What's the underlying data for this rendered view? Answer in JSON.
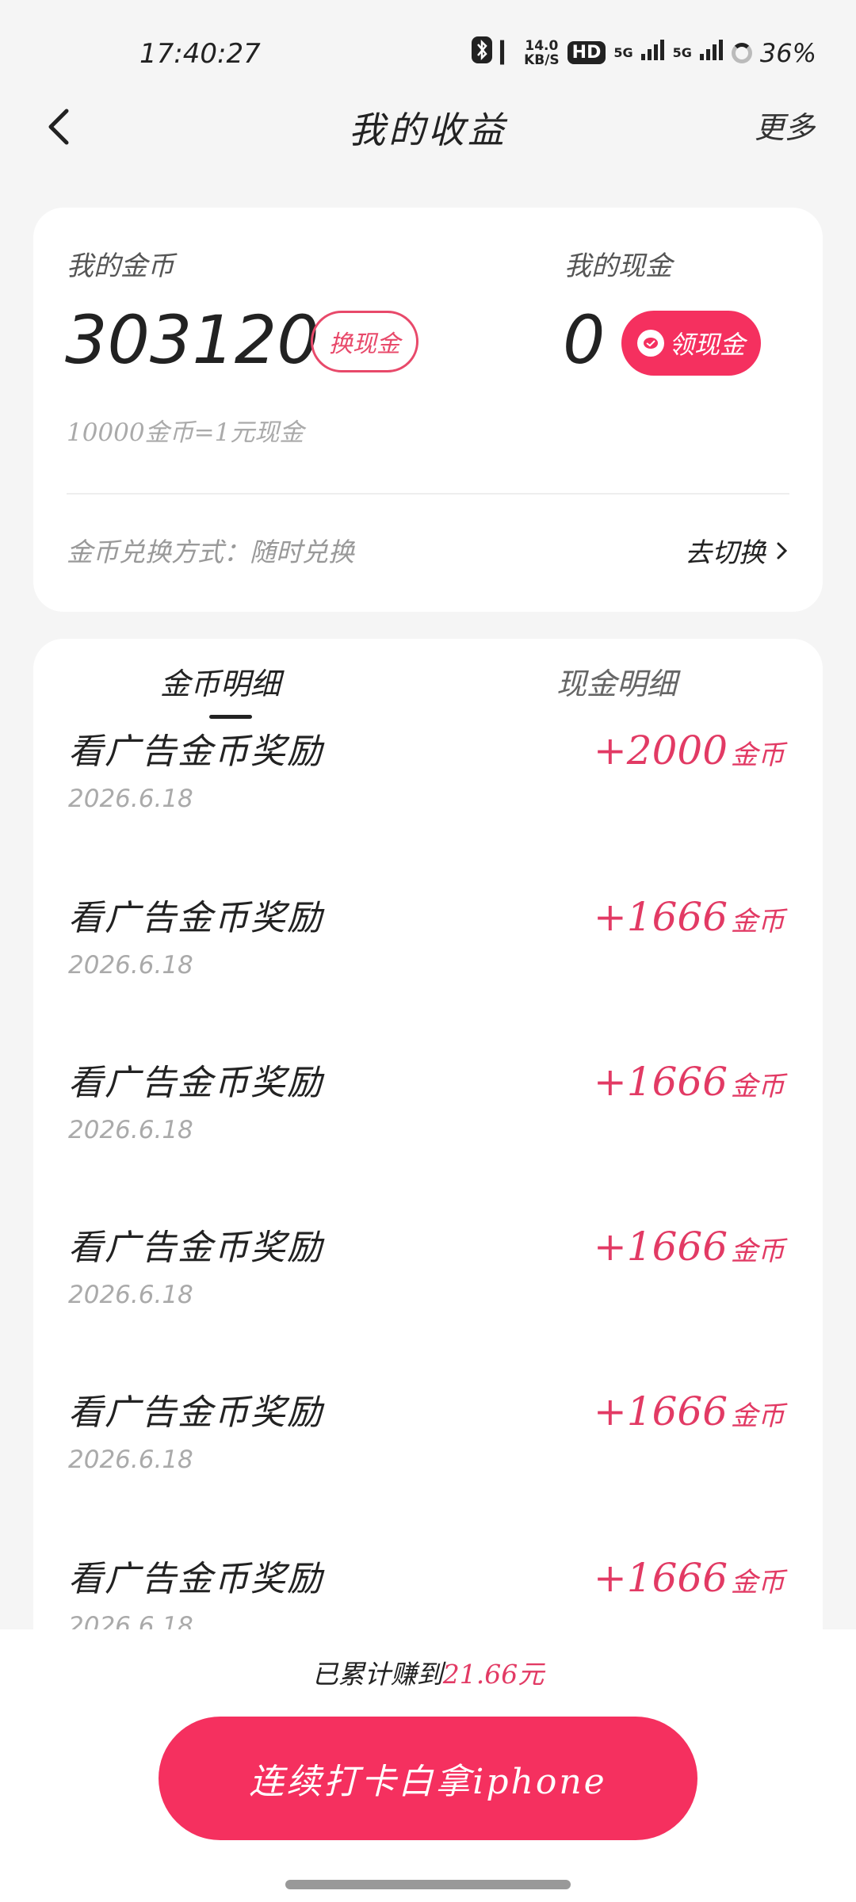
{
  "status": {
    "time": "17:40:27",
    "bluetooth_icon": "bluetooth-icon",
    "speed_value": "14.0",
    "speed_unit": "KB/S",
    "hd_label": "HD",
    "net1": "5G",
    "net2": "5G",
    "battery": "36%"
  },
  "nav": {
    "title": "我的收益",
    "more": "更多"
  },
  "wallet": {
    "coin_label": "我的金币",
    "coin_value": "303120",
    "exchange_btn": "换现金",
    "cash_label": "我的现金",
    "cash_value": "0",
    "claim_btn": "领现金",
    "rate": "10000金币=1元现金",
    "method": "金币兑换方式：随时兑换",
    "switch_link": "去切换"
  },
  "tabs": {
    "coins": "金币明细",
    "cash": "现金明细"
  },
  "records": [
    {
      "title": "看广告金币奖励",
      "date": "2026.6.18",
      "amount": "+2000",
      "unit": "金币"
    },
    {
      "title": "看广告金币奖励",
      "date": "2026.6.18",
      "amount": "+1666",
      "unit": "金币"
    },
    {
      "title": "看广告金币奖励",
      "date": "2026.6.18",
      "amount": "+1666",
      "unit": "金币"
    },
    {
      "title": "看广告金币奖励",
      "date": "2026.6.18",
      "amount": "+1666",
      "unit": "金币"
    },
    {
      "title": "看广告金币奖励",
      "date": "2026.6.18",
      "amount": "+1666",
      "unit": "金币"
    },
    {
      "title": "看广告金币奖励",
      "date": "2026.6.18",
      "amount": "+1666",
      "unit": "金币"
    }
  ],
  "footer": {
    "earned_prefix": "已累计赚到",
    "earned_amount": "21.66元",
    "checkin_btn": "连续打卡白拿iphone"
  },
  "colors": {
    "accent": "#f5305f",
    "amount": "#e23a64",
    "background": "#f5f5f5"
  }
}
